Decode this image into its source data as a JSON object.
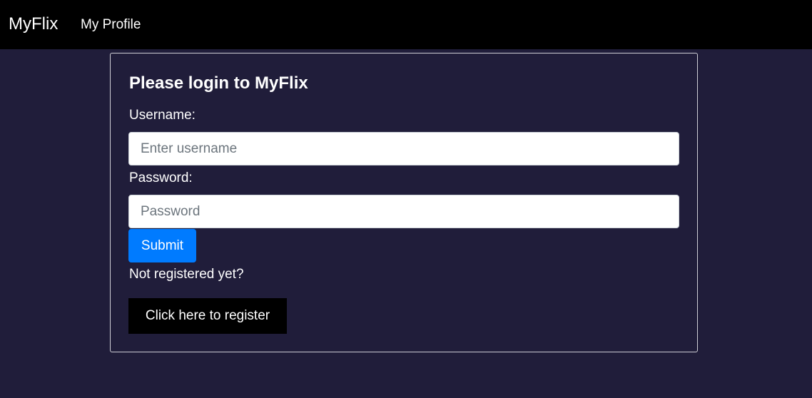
{
  "navbar": {
    "brand": "MyFlix",
    "links": [
      {
        "label": "My Profile"
      }
    ]
  },
  "login": {
    "title": "Please login to MyFlix",
    "username_label": "Username:",
    "username_placeholder": "Enter username",
    "username_value": "",
    "password_label": "Password:",
    "password_placeholder": "Password",
    "password_value": "",
    "submit_label": "Submit",
    "not_registered_text": "Not registered yet?",
    "register_label": "Click here to register"
  },
  "colors": {
    "background": "#201d3a",
    "navbar": "#000000",
    "primary_button": "#007bff",
    "register_button": "#000000",
    "text": "#ffffff"
  }
}
